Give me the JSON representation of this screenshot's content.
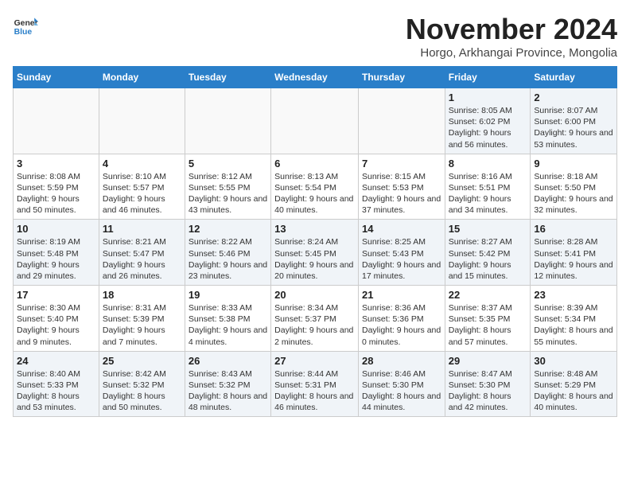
{
  "logo": {
    "general": "General",
    "blue": "Blue"
  },
  "header": {
    "month_year": "November 2024",
    "location": "Horgo, Arkhangai Province, Mongolia"
  },
  "days_of_week": [
    "Sunday",
    "Monday",
    "Tuesday",
    "Wednesday",
    "Thursday",
    "Friday",
    "Saturday"
  ],
  "weeks": [
    [
      {
        "day": "",
        "info": ""
      },
      {
        "day": "",
        "info": ""
      },
      {
        "day": "",
        "info": ""
      },
      {
        "day": "",
        "info": ""
      },
      {
        "day": "",
        "info": ""
      },
      {
        "day": "1",
        "info": "Sunrise: 8:05 AM\nSunset: 6:02 PM\nDaylight: 9 hours and 56 minutes."
      },
      {
        "day": "2",
        "info": "Sunrise: 8:07 AM\nSunset: 6:00 PM\nDaylight: 9 hours and 53 minutes."
      }
    ],
    [
      {
        "day": "3",
        "info": "Sunrise: 8:08 AM\nSunset: 5:59 PM\nDaylight: 9 hours and 50 minutes."
      },
      {
        "day": "4",
        "info": "Sunrise: 8:10 AM\nSunset: 5:57 PM\nDaylight: 9 hours and 46 minutes."
      },
      {
        "day": "5",
        "info": "Sunrise: 8:12 AM\nSunset: 5:55 PM\nDaylight: 9 hours and 43 minutes."
      },
      {
        "day": "6",
        "info": "Sunrise: 8:13 AM\nSunset: 5:54 PM\nDaylight: 9 hours and 40 minutes."
      },
      {
        "day": "7",
        "info": "Sunrise: 8:15 AM\nSunset: 5:53 PM\nDaylight: 9 hours and 37 minutes."
      },
      {
        "day": "8",
        "info": "Sunrise: 8:16 AM\nSunset: 5:51 PM\nDaylight: 9 hours and 34 minutes."
      },
      {
        "day": "9",
        "info": "Sunrise: 8:18 AM\nSunset: 5:50 PM\nDaylight: 9 hours and 32 minutes."
      }
    ],
    [
      {
        "day": "10",
        "info": "Sunrise: 8:19 AM\nSunset: 5:48 PM\nDaylight: 9 hours and 29 minutes."
      },
      {
        "day": "11",
        "info": "Sunrise: 8:21 AM\nSunset: 5:47 PM\nDaylight: 9 hours and 26 minutes."
      },
      {
        "day": "12",
        "info": "Sunrise: 8:22 AM\nSunset: 5:46 PM\nDaylight: 9 hours and 23 minutes."
      },
      {
        "day": "13",
        "info": "Sunrise: 8:24 AM\nSunset: 5:45 PM\nDaylight: 9 hours and 20 minutes."
      },
      {
        "day": "14",
        "info": "Sunrise: 8:25 AM\nSunset: 5:43 PM\nDaylight: 9 hours and 17 minutes."
      },
      {
        "day": "15",
        "info": "Sunrise: 8:27 AM\nSunset: 5:42 PM\nDaylight: 9 hours and 15 minutes."
      },
      {
        "day": "16",
        "info": "Sunrise: 8:28 AM\nSunset: 5:41 PM\nDaylight: 9 hours and 12 minutes."
      }
    ],
    [
      {
        "day": "17",
        "info": "Sunrise: 8:30 AM\nSunset: 5:40 PM\nDaylight: 9 hours and 9 minutes."
      },
      {
        "day": "18",
        "info": "Sunrise: 8:31 AM\nSunset: 5:39 PM\nDaylight: 9 hours and 7 minutes."
      },
      {
        "day": "19",
        "info": "Sunrise: 8:33 AM\nSunset: 5:38 PM\nDaylight: 9 hours and 4 minutes."
      },
      {
        "day": "20",
        "info": "Sunrise: 8:34 AM\nSunset: 5:37 PM\nDaylight: 9 hours and 2 minutes."
      },
      {
        "day": "21",
        "info": "Sunrise: 8:36 AM\nSunset: 5:36 PM\nDaylight: 9 hours and 0 minutes."
      },
      {
        "day": "22",
        "info": "Sunrise: 8:37 AM\nSunset: 5:35 PM\nDaylight: 8 hours and 57 minutes."
      },
      {
        "day": "23",
        "info": "Sunrise: 8:39 AM\nSunset: 5:34 PM\nDaylight: 8 hours and 55 minutes."
      }
    ],
    [
      {
        "day": "24",
        "info": "Sunrise: 8:40 AM\nSunset: 5:33 PM\nDaylight: 8 hours and 53 minutes."
      },
      {
        "day": "25",
        "info": "Sunrise: 8:42 AM\nSunset: 5:32 PM\nDaylight: 8 hours and 50 minutes."
      },
      {
        "day": "26",
        "info": "Sunrise: 8:43 AM\nSunset: 5:32 PM\nDaylight: 8 hours and 48 minutes."
      },
      {
        "day": "27",
        "info": "Sunrise: 8:44 AM\nSunset: 5:31 PM\nDaylight: 8 hours and 46 minutes."
      },
      {
        "day": "28",
        "info": "Sunrise: 8:46 AM\nSunset: 5:30 PM\nDaylight: 8 hours and 44 minutes."
      },
      {
        "day": "29",
        "info": "Sunrise: 8:47 AM\nSunset: 5:30 PM\nDaylight: 8 hours and 42 minutes."
      },
      {
        "day": "30",
        "info": "Sunrise: 8:48 AM\nSunset: 5:29 PM\nDaylight: 8 hours and 40 minutes."
      }
    ]
  ]
}
